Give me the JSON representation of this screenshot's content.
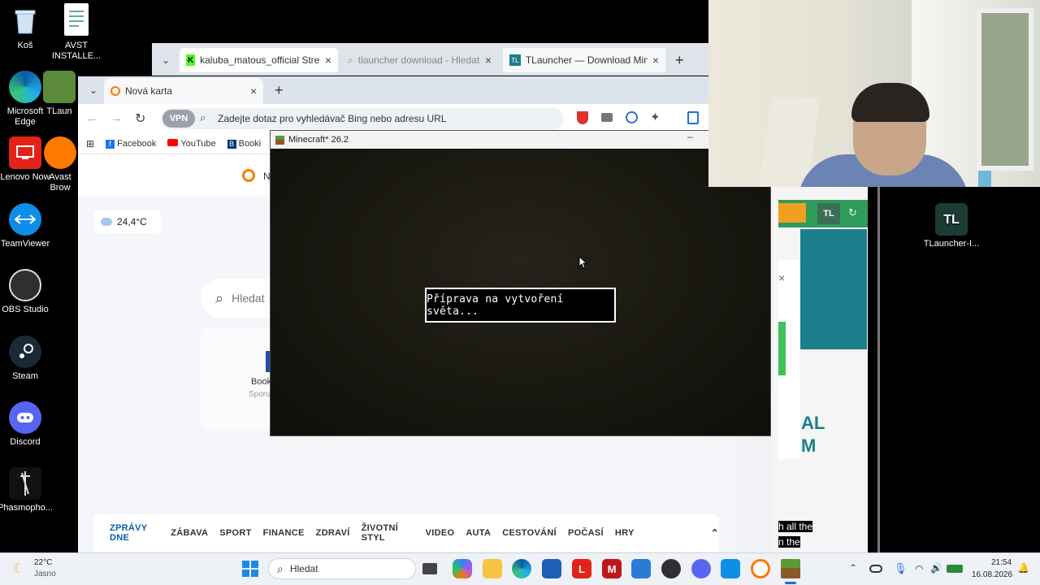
{
  "desktop": {
    "icons": [
      {
        "label": "Koš",
        "icon": "recycle-bin-icon"
      },
      {
        "label": "AVST INSTALLE...",
        "icon": "installer-file-icon"
      },
      {
        "label": "Microsoft Edge",
        "icon": "edge-icon"
      },
      {
        "label": "TLaun",
        "icon": "tlauncher-shortcut-icon"
      },
      {
        "label": "Lenovo Now",
        "icon": "lenovo-now-icon"
      },
      {
        "label": "Avast Brow",
        "icon": "avast-browser-icon"
      },
      {
        "label": "TeamViewer",
        "icon": "teamviewer-icon"
      },
      {
        "label": "OBS Studio",
        "icon": "obs-icon"
      },
      {
        "label": "Steam",
        "icon": "steam-icon"
      },
      {
        "label": "Discord",
        "icon": "discord-icon"
      },
      {
        "label": "Phasmopho...",
        "icon": "phasmophobia-icon"
      },
      {
        "label": "TLauncher-I...",
        "icon": "tlauncher-installer-icon"
      }
    ]
  },
  "back_browser": {
    "tabs": [
      {
        "label": "kaluba_matous_official Stream - W"
      },
      {
        "label": "tlauncher download - Hledat"
      },
      {
        "label": "TLauncher — Download Minecraft"
      }
    ],
    "new_tab_symbol": "+"
  },
  "front_browser": {
    "tab_label": "Nová karta",
    "new_tab_symbol": "+",
    "vpn_label": "VPN",
    "address_placeholder": "Zadejte dotaz pro vyhledávač Bing nebo adresu URL",
    "bookmarks": [
      "Facebook",
      "YouTube",
      "Booki"
    ],
    "weather": "24,4°C",
    "search_placeholder": "Hledat",
    "tile_label": "Book",
    "tile_sub": "Sponz",
    "nav_letter": "N",
    "news_tabs": [
      "ZPRÁVY DNE",
      "ZÁBAVA",
      "SPORT",
      "FINANCE",
      "ZDRAVÍ",
      "ŽIVOTNÍ STYL",
      "VIDEO",
      "AUTA",
      "CESTOVÁNÍ",
      "POČASÍ",
      "HRY"
    ]
  },
  "minecraft": {
    "title": "Minecraft* 26.2",
    "status": "Příprava na vytvoření světa..."
  },
  "tlauncher_page": {
    "logo": "TL",
    "big_text_1": "AL",
    "big_text_2": "M",
    "text_1": "h all the",
    "text_2": "n the"
  },
  "taskbar": {
    "weather_temp": "22°C",
    "weather_desc": "Jasno",
    "search_placeholder": "Hledat",
    "time": "21:54",
    "date": "16.08.2026"
  }
}
